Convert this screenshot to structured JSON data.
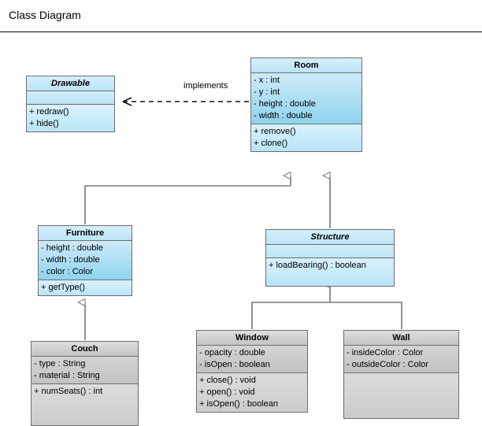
{
  "header": {
    "title": "Class Diagram"
  },
  "diagram": {
    "type": "uml-class-diagram",
    "colors": {
      "blue_fill": "#a8ddf0",
      "blue_header": "#c7e8f9",
      "gray_fill": "#c8c8c8",
      "gray_header": "#d6d6d6",
      "border": "#6e6e6e",
      "line": "#787878",
      "text": "#000000",
      "background": "#ffffff"
    },
    "classes": [
      {
        "id": "drawable",
        "name": "Drawable",
        "stereotype": "interface",
        "italic": true,
        "fill": "blue",
        "attributes": [],
        "operations": [
          "+ redraw()",
          "+ hide()"
        ]
      },
      {
        "id": "room",
        "name": "Room",
        "stereotype": "class",
        "italic": false,
        "fill": "blue",
        "attributes": [
          "- x : int",
          "- y : int",
          "- height : double",
          "- width : double"
        ],
        "operations": [
          "+ remove()",
          "+ clone()"
        ]
      },
      {
        "id": "furniture",
        "name": "Furniture",
        "stereotype": "class",
        "italic": false,
        "fill": "blue",
        "attributes": [
          "- height : double",
          "- width : double",
          "- color : Color"
        ],
        "operations": [
          "+ getType()"
        ]
      },
      {
        "id": "structure",
        "name": "Structure",
        "stereotype": "abstract",
        "italic": true,
        "fill": "blue",
        "attributes": [],
        "operations": [
          "+ loadBearing() : boolean"
        ]
      },
      {
        "id": "couch",
        "name": "Couch",
        "stereotype": "class",
        "italic": false,
        "fill": "gray",
        "attributes": [
          "- type : String",
          "- material : String"
        ],
        "operations": [
          "+ numSeats() : int"
        ]
      },
      {
        "id": "window",
        "name": "Window",
        "stereotype": "class",
        "italic": false,
        "fill": "gray",
        "attributes": [
          "- opacity : double",
          "- isOpen : boolean"
        ],
        "operations": [
          "+ close() : void",
          "+ open() : void",
          "+ isOpen() : boolean"
        ]
      },
      {
        "id": "wall",
        "name": "Wall",
        "stereotype": "class",
        "italic": false,
        "fill": "gray",
        "attributes": [
          "- insideColor : Color",
          "- outsideColor : Color"
        ],
        "operations": []
      }
    ],
    "relationships": [
      {
        "id": "rel-room-drawable",
        "kind": "realization",
        "label": "implements",
        "from": "room",
        "to": "drawable",
        "line_style": "dashed",
        "arrow": "open-arrow"
      },
      {
        "id": "rel-furniture-room",
        "kind": "generalization",
        "label": "",
        "from": "furniture",
        "to": "room",
        "line_style": "solid",
        "arrow": "hollow-triangle"
      },
      {
        "id": "rel-structure-room",
        "kind": "generalization",
        "label": "",
        "from": "structure",
        "to": "room",
        "line_style": "solid",
        "arrow": "hollow-triangle"
      },
      {
        "id": "rel-couch-furniture",
        "kind": "generalization",
        "label": "",
        "from": "couch",
        "to": "furniture",
        "line_style": "solid",
        "arrow": "hollow-triangle"
      },
      {
        "id": "rel-window-structure",
        "kind": "generalization",
        "label": "",
        "from": "window",
        "to": "structure",
        "line_style": "solid",
        "arrow": "hollow-triangle"
      },
      {
        "id": "rel-wall-structure",
        "kind": "generalization",
        "label": "",
        "from": "wall",
        "to": "structure",
        "line_style": "solid",
        "arrow": "hollow-triangle"
      }
    ]
  }
}
